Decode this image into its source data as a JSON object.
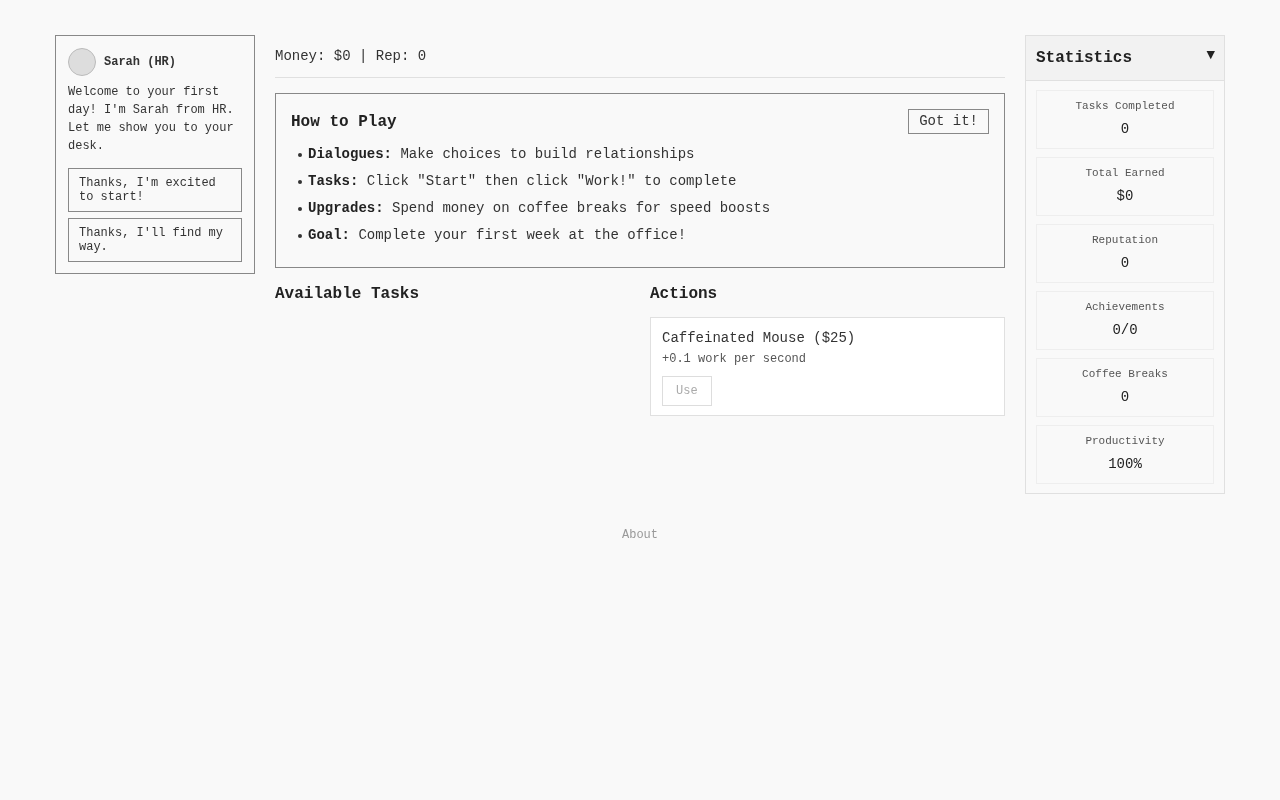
{
  "dialogue": {
    "speaker": "Sarah (HR)",
    "message": "Welcome to your first day! I'm Sarah from HR. Let me show you to your desk.",
    "choices": [
      "Thanks, I'm excited to start!",
      "Thanks, I'll find my way."
    ]
  },
  "status_bar": {
    "text": "Money: $0 | Rep: 0"
  },
  "how_to_play": {
    "title": "How to Play",
    "dismiss_button": "Got it!",
    "items": [
      "**Dialogues:** Make choices to build relationships",
      "**Tasks:** Click \"Start\" then click \"Work!\" to complete",
      "**Upgrades:** Spend money on coffee breaks for speed boosts",
      "**Goal:** Complete your first week at the office!"
    ]
  },
  "tasks": {
    "title": "Available Tasks"
  },
  "actions": {
    "title": "Actions",
    "items": [
      {
        "name": "Caffeinated Mouse ($25)",
        "description": "+0.1 work per second",
        "button": "Use",
        "disabled": true
      }
    ]
  },
  "statistics": {
    "title": "Statistics",
    "toggle": "▼",
    "expanded": true,
    "items": [
      {
        "label": "Tasks Completed",
        "value": "0"
      },
      {
        "label": "Total Earned",
        "value": "$0"
      },
      {
        "label": "Reputation",
        "value": "0"
      },
      {
        "label": "Achievements",
        "value": "0/0"
      },
      {
        "label": "Coffee Breaks",
        "value": "0"
      },
      {
        "label": "Productivity",
        "value": "100%"
      }
    ]
  },
  "footer": {
    "link": "About"
  }
}
